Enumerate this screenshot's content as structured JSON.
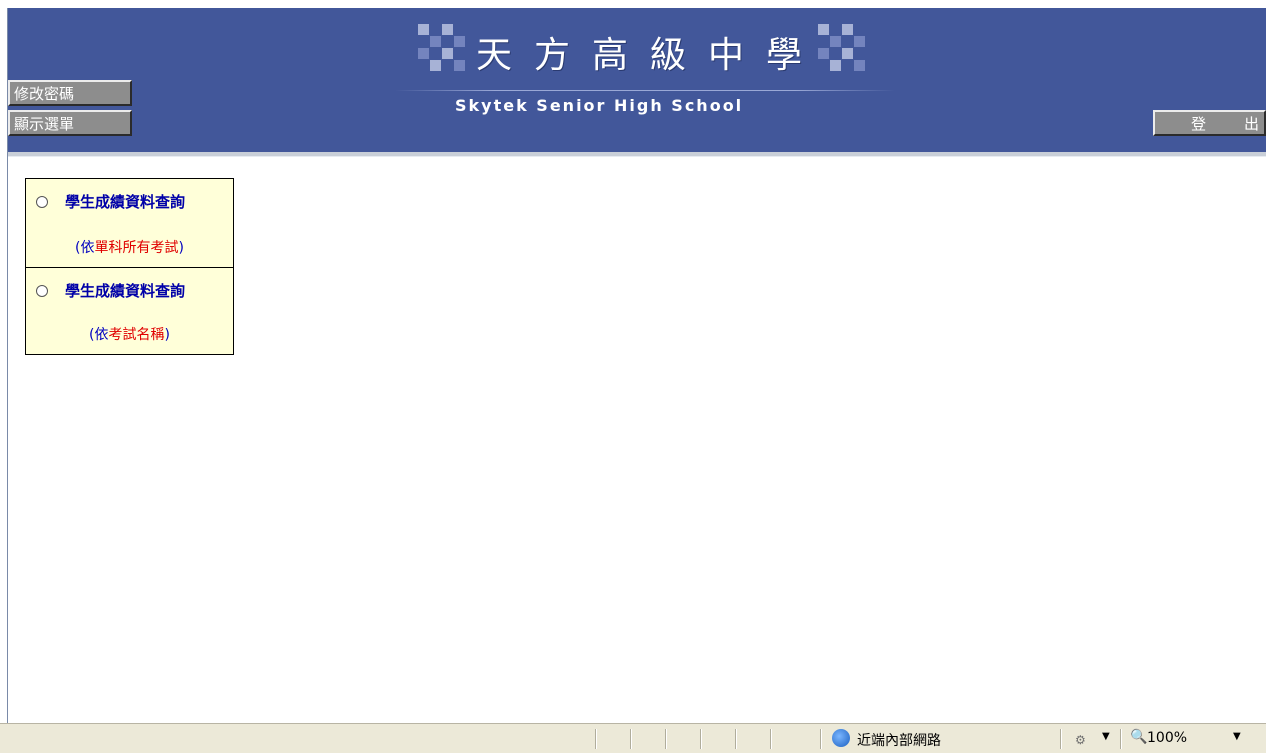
{
  "header": {
    "school_name_zh": "天方高級中學",
    "school_name_en": "Skytek Senior High School",
    "change_password_label": "修改密碼",
    "show_menu_label": "顯示選單",
    "logout_label": "登出"
  },
  "menu": {
    "items": [
      {
        "title": "學生成績資料查詢",
        "sub_open": "(",
        "sub_blue": "依",
        "sub_red": "單科所有考試",
        "sub_close": ")"
      },
      {
        "title": "學生成績資料查詢",
        "sub_open": "(",
        "sub_blue": "依",
        "sub_red": "考試名稱",
        "sub_close": ")"
      }
    ]
  },
  "statusbar": {
    "zone": "近端內部網路",
    "zoom": "100%"
  },
  "colors": {
    "header_bg": "#42579a",
    "menu_bg": "#ffffd9",
    "menu_title": "#0000a8",
    "accent_red": "#e00000"
  }
}
